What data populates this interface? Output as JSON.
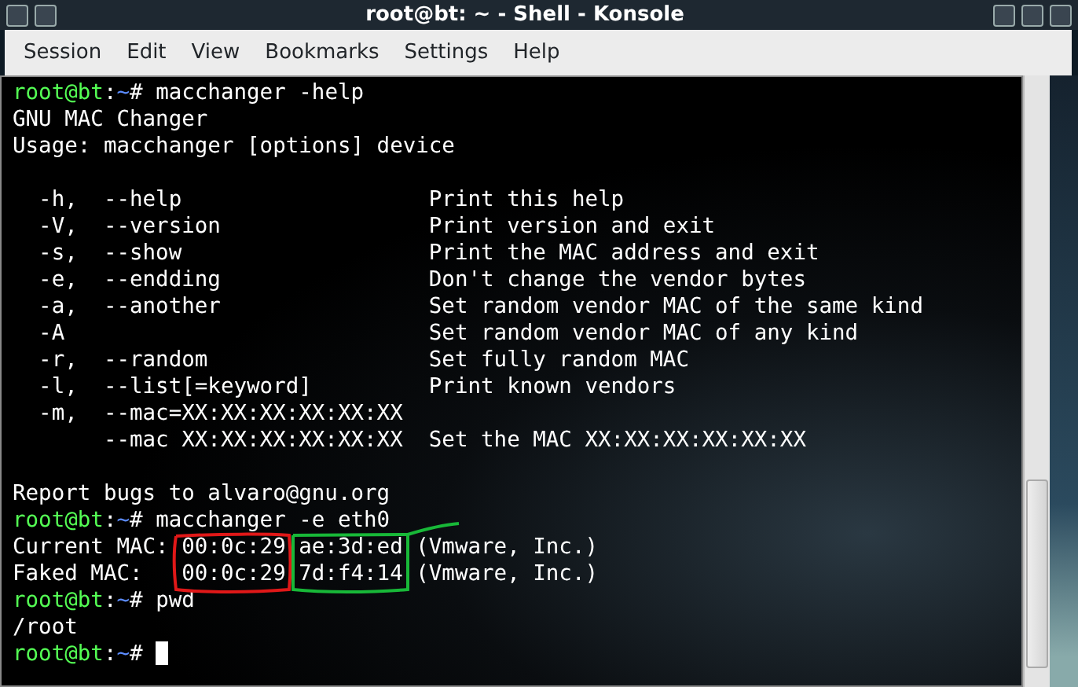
{
  "window": {
    "title": "root@bt: ~ - Shell - Konsole"
  },
  "menu": [
    "Session",
    "Edit",
    "View",
    "Bookmarks",
    "Settings",
    "Help"
  ],
  "terminal_lines": [
    {
      "kind": "prompt",
      "prompt": {
        "user": "root@bt",
        "sep": ":",
        "dir": "~",
        "sign": "#"
      },
      "command": "macchanger -help"
    },
    {
      "kind": "output",
      "text": "GNU MAC Changer"
    },
    {
      "kind": "output",
      "text": "Usage: macchanger [options] device"
    },
    {
      "kind": "blank"
    },
    {
      "kind": "output",
      "text": "  -h,  --help                   Print this help"
    },
    {
      "kind": "output",
      "text": "  -V,  --version                Print version and exit"
    },
    {
      "kind": "output",
      "text": "  -s,  --show                   Print the MAC address and exit"
    },
    {
      "kind": "output",
      "text": "  -e,  --endding                Don't change the vendor bytes"
    },
    {
      "kind": "output",
      "text": "  -a,  --another                Set random vendor MAC of the same kind"
    },
    {
      "kind": "output",
      "text": "  -A                            Set random vendor MAC of any kind"
    },
    {
      "kind": "output",
      "text": "  -r,  --random                 Set fully random MAC"
    },
    {
      "kind": "output",
      "text": "  -l,  --list[=keyword]         Print known vendors"
    },
    {
      "kind": "output",
      "text": "  -m,  --mac=XX:XX:XX:XX:XX:XX"
    },
    {
      "kind": "output",
      "text": "       --mac XX:XX:XX:XX:XX:XX  Set the MAC XX:XX:XX:XX:XX:XX"
    },
    {
      "kind": "blank"
    },
    {
      "kind": "output",
      "text": "Report bugs to alvaro@gnu.org"
    },
    {
      "kind": "prompt",
      "prompt": {
        "user": "root@bt",
        "sep": ":",
        "dir": "~",
        "sign": "#"
      },
      "command": "macchanger -e eth0"
    },
    {
      "kind": "output",
      "text": "Current MAC: 00:0c:29 ae:3d:ed (Vmware, Inc.)"
    },
    {
      "kind": "output",
      "text": "Faked MAC:   00:0c:29 7d:f4:14 (Vmware, Inc.)"
    },
    {
      "kind": "prompt",
      "prompt": {
        "user": "root@bt",
        "sep": ":",
        "dir": "~",
        "sign": "#"
      },
      "command": "pwd"
    },
    {
      "kind": "output",
      "text": "/root"
    },
    {
      "kind": "prompt",
      "prompt": {
        "user": "root@bt",
        "sep": ":",
        "dir": "~",
        "sign": "#"
      },
      "cursor": true
    }
  ]
}
